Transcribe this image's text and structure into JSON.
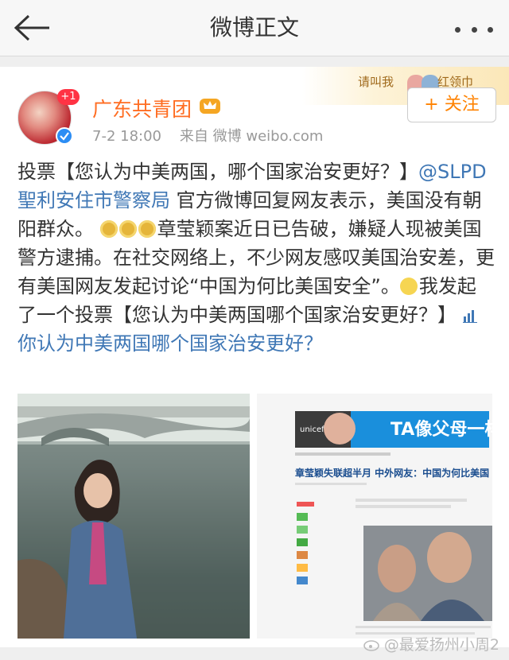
{
  "topbar": {
    "title": "微博正文"
  },
  "banner": {
    "text_left": "请叫我",
    "text_right": "红领巾"
  },
  "post": {
    "avatar_badge": "+1",
    "username": "广东共青团",
    "timestamp": "7-2 18:00",
    "source": "来自 微博 weibo.com",
    "follow_label": "+ 关注",
    "text": {
      "p1": "投票【您认为中美两国，哪个国家治安更好？】",
      "mention": "@SLPD聖利安住市警察局",
      "p2": " 官方微博回复网友表示，美国没有朝阳群众。",
      "p3": "章莹颖案近日已告破，嫌疑人现被美国警方逮捕。在社交网络上，不少网友感叹美国治安差，更有美国网友发起讨论“中国为何比美国安全”。",
      "p4": "我发起了一个投票【您认为中美两国哪个国家治安更好？】",
      "poll_link": "你认为中美两国哪个国家治安更好？"
    }
  },
  "image_right": {
    "banner_text": "TA像父母一样",
    "logo_text": "unicef",
    "headline": "章莹颖失联超半月 中外网友：中国为何比美国"
  },
  "watermark": {
    "text": "@最爱扬州小周2"
  }
}
